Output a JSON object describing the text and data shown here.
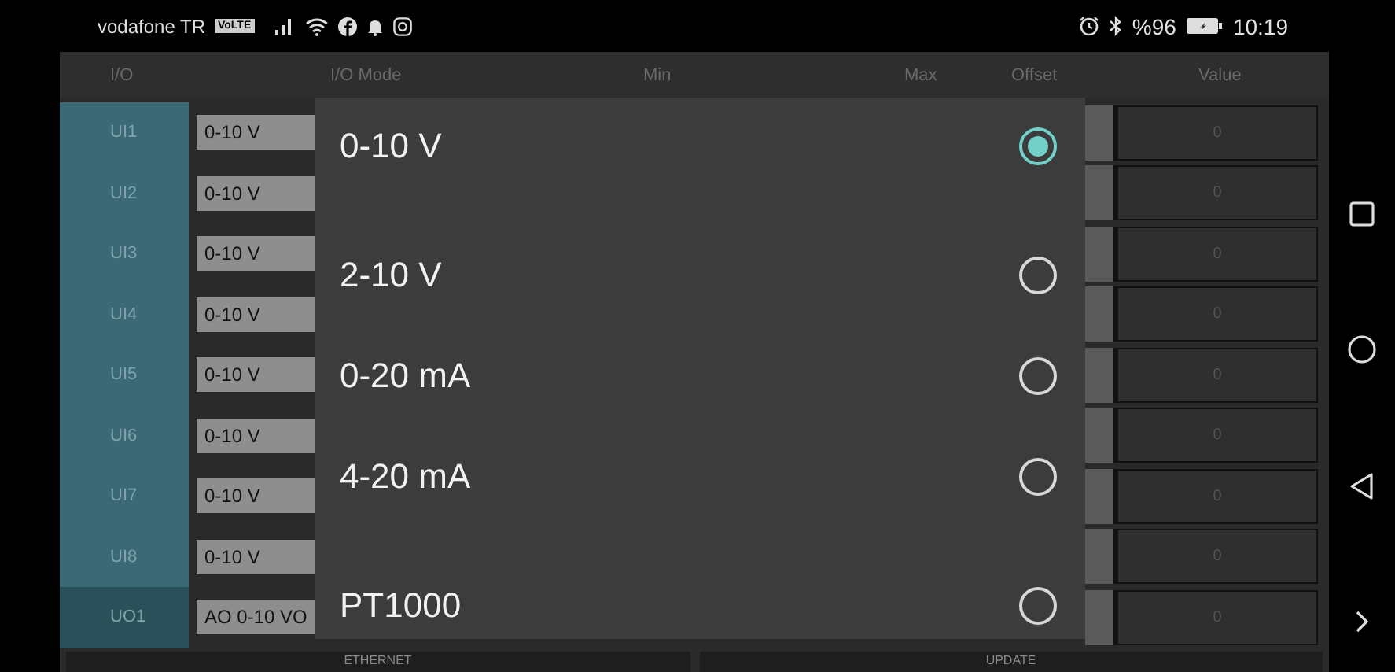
{
  "status_bar": {
    "carrier": "vodafone TR",
    "volte": "VoLTE",
    "battery_text": "%96",
    "time": "10:19"
  },
  "table": {
    "columns": [
      "I/O",
      "I/O Mode",
      "Min",
      "Max",
      "Offset",
      "Value"
    ],
    "rows": [
      {
        "io": "UI1",
        "mode": "0-10 V",
        "value": "0",
        "kind": "input"
      },
      {
        "io": "UI2",
        "mode": "0-10 V",
        "value": "0",
        "kind": "input"
      },
      {
        "io": "UI3",
        "mode": "0-10 V",
        "value": "0",
        "kind": "input"
      },
      {
        "io": "UI4",
        "mode": "0-10 V",
        "value": "0",
        "kind": "input"
      },
      {
        "io": "UI5",
        "mode": "0-10 V",
        "value": "0",
        "kind": "input"
      },
      {
        "io": "UI6",
        "mode": "0-10 V",
        "value": "0",
        "kind": "input"
      },
      {
        "io": "UI7",
        "mode": "0-10 V",
        "value": "0",
        "kind": "input"
      },
      {
        "io": "UI8",
        "mode": "0-10 V",
        "value": "0",
        "kind": "input"
      },
      {
        "io": "UO1",
        "mode": "AO 0-10 VO",
        "value": "0",
        "kind": "output"
      }
    ]
  },
  "bottom_buttons": [
    "ETHERNET",
    "UPDATE"
  ],
  "mode_dialog": {
    "options": [
      {
        "label": "0-10 V",
        "selected": true
      },
      {
        "label": "2-10 V",
        "selected": false
      },
      {
        "label": "0-20 mA",
        "selected": false
      },
      {
        "label": "4-20 mA",
        "selected": false
      },
      {
        "label": "PT1000",
        "selected": false
      }
    ]
  }
}
